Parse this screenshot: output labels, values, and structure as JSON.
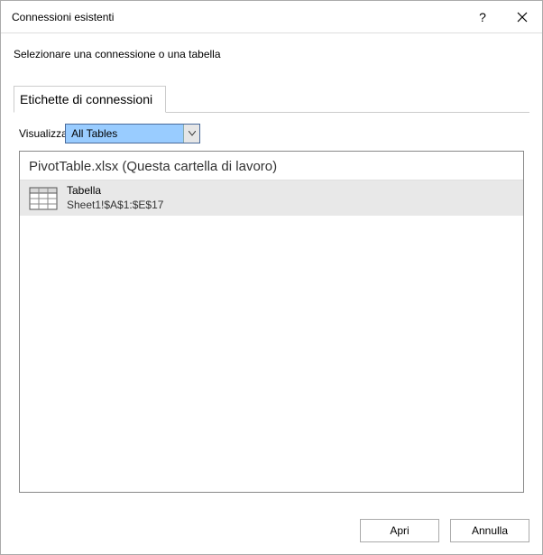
{
  "titlebar": {
    "title": "Connessioni esistenti"
  },
  "instruction": "Selezionare una connessione o una tabella",
  "tabs": {
    "active": "Etichette di connessioni"
  },
  "view": {
    "label": "Visualizza:",
    "selected": "All Tables"
  },
  "list": {
    "group_header": "PivotTable.xlsx (Questa cartella di lavoro)",
    "items": [
      {
        "name": "Tabella",
        "ref": "Sheet1!$A$1:$E$17"
      }
    ]
  },
  "footer": {
    "open": "Apri",
    "cancel": "Annulla"
  }
}
